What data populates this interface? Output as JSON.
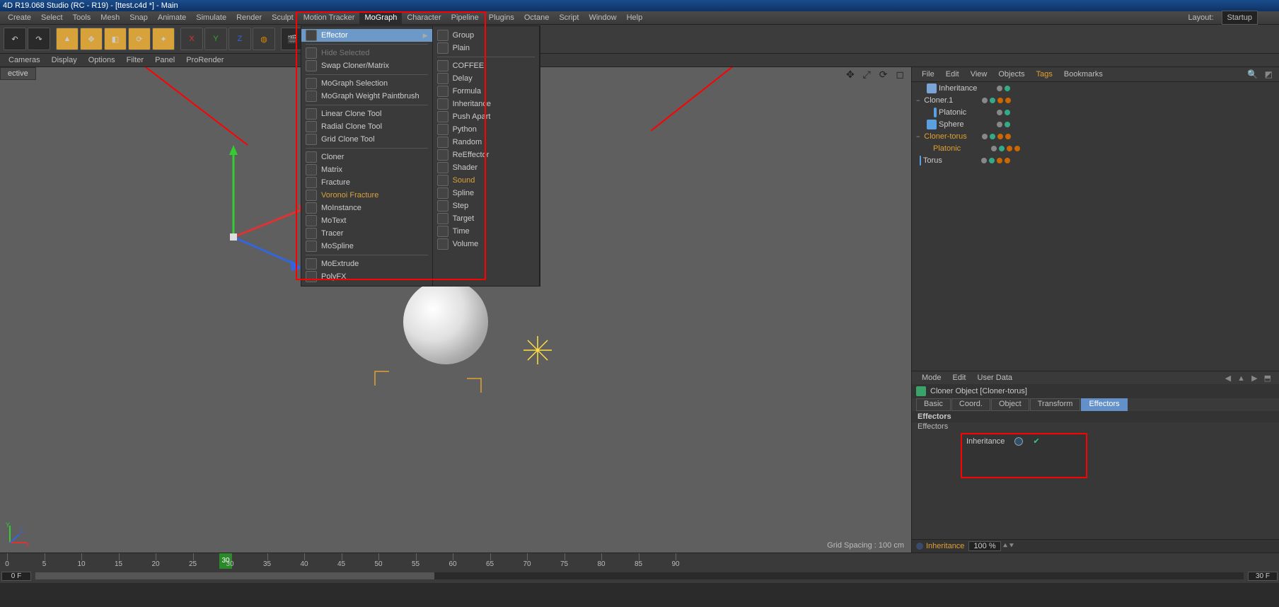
{
  "title": "4D R19.068 Studio (RC - R19) - [ttest.c4d *] - Main",
  "menubar": [
    "Create",
    "Select",
    "Tools",
    "Mesh",
    "Snap",
    "Animate",
    "Simulate",
    "Render",
    "Sculpt",
    "Motion Tracker",
    "MoGraph",
    "Character",
    "Pipeline",
    "Plugins",
    "Octane",
    "Script",
    "Window",
    "Help"
  ],
  "menubar_active": "MoGraph",
  "layout_label": "Layout:",
  "layout_value": "Startup",
  "subbar": [
    "Cameras",
    "Display",
    "Options",
    "Filter",
    "Panel",
    "ProRender"
  ],
  "mograph_menu": {
    "col1": [
      {
        "label": "Effector",
        "hover": true,
        "sub": true
      },
      {
        "sep": true
      },
      {
        "label": "Hide Selected",
        "dis": true
      },
      {
        "label": "Swap Cloner/Matrix"
      },
      {
        "sep": true
      },
      {
        "label": "MoGraph Selection"
      },
      {
        "label": "MoGraph Weight Paintbrush"
      },
      {
        "sep": true
      },
      {
        "label": "Linear Clone Tool"
      },
      {
        "label": "Radial Clone Tool"
      },
      {
        "label": "Grid Clone Tool"
      },
      {
        "sep": true
      },
      {
        "label": "Cloner"
      },
      {
        "label": "Matrix"
      },
      {
        "label": "Fracture"
      },
      {
        "label": "Voronoi Fracture",
        "orange": true
      },
      {
        "label": "MoInstance"
      },
      {
        "label": "MoText"
      },
      {
        "label": "Tracer"
      },
      {
        "label": "MoSpline"
      },
      {
        "sep": true
      },
      {
        "label": "MoExtrude"
      },
      {
        "label": "PolyFX"
      }
    ],
    "col2": [
      {
        "label": "Group"
      },
      {
        "label": "Plain"
      },
      {
        "sep": true
      },
      {
        "label": "COFFEE"
      },
      {
        "label": "Delay"
      },
      {
        "label": "Formula"
      },
      {
        "label": "Inheritance"
      },
      {
        "label": "Push Apart"
      },
      {
        "label": "Python"
      },
      {
        "label": "Random"
      },
      {
        "label": "ReEffector"
      },
      {
        "label": "Shader"
      },
      {
        "label": "Sound",
        "orange": true
      },
      {
        "label": "Spline"
      },
      {
        "label": "Step"
      },
      {
        "label": "Target"
      },
      {
        "label": "Time"
      },
      {
        "label": "Volume"
      }
    ]
  },
  "viewport": {
    "tab": "ective",
    "status": "Grid Spacing : 100 cm"
  },
  "obj_panel_tabs": [
    "File",
    "Edit",
    "View",
    "Objects",
    "Tags",
    "Bookmarks"
  ],
  "obj_panel_active": "Tags",
  "objects": [
    {
      "name": "Inheritance",
      "indent": 0,
      "ico": "#7aa3d6",
      "dots": [
        "#888",
        "#3a8"
      ]
    },
    {
      "name": "Cloner.1",
      "indent": 0,
      "ico": "#3aa36a",
      "exp": "−",
      "dots": [
        "#888",
        "#3a8",
        "#c60",
        "#c60"
      ]
    },
    {
      "name": "Platonic",
      "indent": 1,
      "ico": "#5aa0e0",
      "dots": [
        "#888",
        "#3a8"
      ]
    },
    {
      "name": "Sphere",
      "indent": 0,
      "ico": "#5aa0e0",
      "dots": [
        "#888",
        "#3a8"
      ]
    },
    {
      "name": "Cloner-torus",
      "indent": 0,
      "ico": "#3aa36a",
      "exp": "−",
      "orange": true,
      "dots": [
        "#888",
        "#3a8",
        "#c60",
        "#c60"
      ]
    },
    {
      "name": "Platonic",
      "indent": 1,
      "ico": "#5aa0e0",
      "orange": true,
      "dots": [
        "#888",
        "#3a8",
        "#c60",
        "#c60"
      ]
    },
    {
      "name": "Torus",
      "indent": 0,
      "ico": "#5aa0e0",
      "dots": [
        "#888",
        "#3a8",
        "#c60",
        "#c60"
      ]
    }
  ],
  "attr_tabs": [
    "Mode",
    "Edit",
    "User Data"
  ],
  "attr_title": "Cloner Object [Cloner-torus]",
  "attr_tabs2": [
    "Basic",
    "Coord.",
    "Object",
    "Transform",
    "Effectors"
  ],
  "attr_tab2_active": "Effectors",
  "attr_section": "Effectors",
  "eff_label": "Effectors",
  "eff_item": "Inheritance",
  "bottom": {
    "label": "Inheritance",
    "percent": "100 %"
  },
  "timeline": {
    "start": "0 F",
    "end": "30 F",
    "cur": "30",
    "ticks": [
      0,
      5,
      10,
      15,
      20,
      25,
      30,
      35,
      40,
      45,
      50,
      55,
      60,
      65,
      70,
      75,
      80,
      85,
      90
    ]
  }
}
